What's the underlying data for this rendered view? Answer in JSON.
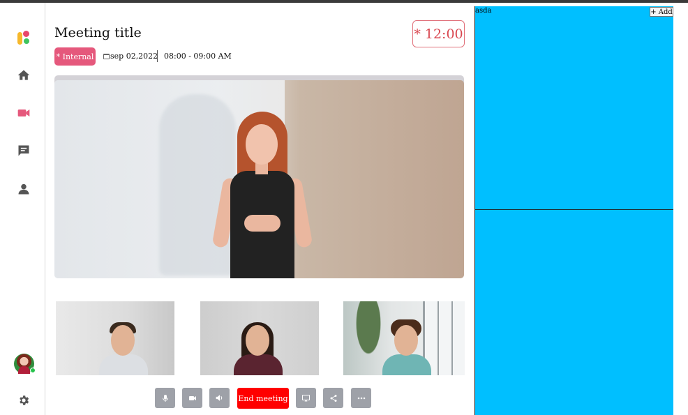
{
  "meeting": {
    "title": "Meeting title",
    "timer": "* 12:00",
    "tag": "* Internal",
    "date": "sep 02,2022",
    "time": "08:00 - 09:00 AM"
  },
  "sidebar": {
    "items": [
      {
        "icon": "home-icon"
      },
      {
        "icon": "video-icon",
        "active": true
      },
      {
        "icon": "chat-icon"
      },
      {
        "icon": "user-icon"
      }
    ],
    "bottom": [
      {
        "icon": "avatar"
      },
      {
        "icon": "gear-icon"
      }
    ]
  },
  "controls": {
    "end_label": "End meeting",
    "buttons": [
      "mic-icon",
      "camera-icon",
      "speaker-icon",
      "screen-share-icon",
      "share-icon",
      "more-icon"
    ]
  },
  "panel": {
    "label": "asda",
    "add_label": "+ Add"
  },
  "colors": {
    "accent": "#e5587c",
    "timer": "#d9464f",
    "end_button": "#ff0000",
    "panel": "#00bfff",
    "control": "#9ea1a8"
  }
}
